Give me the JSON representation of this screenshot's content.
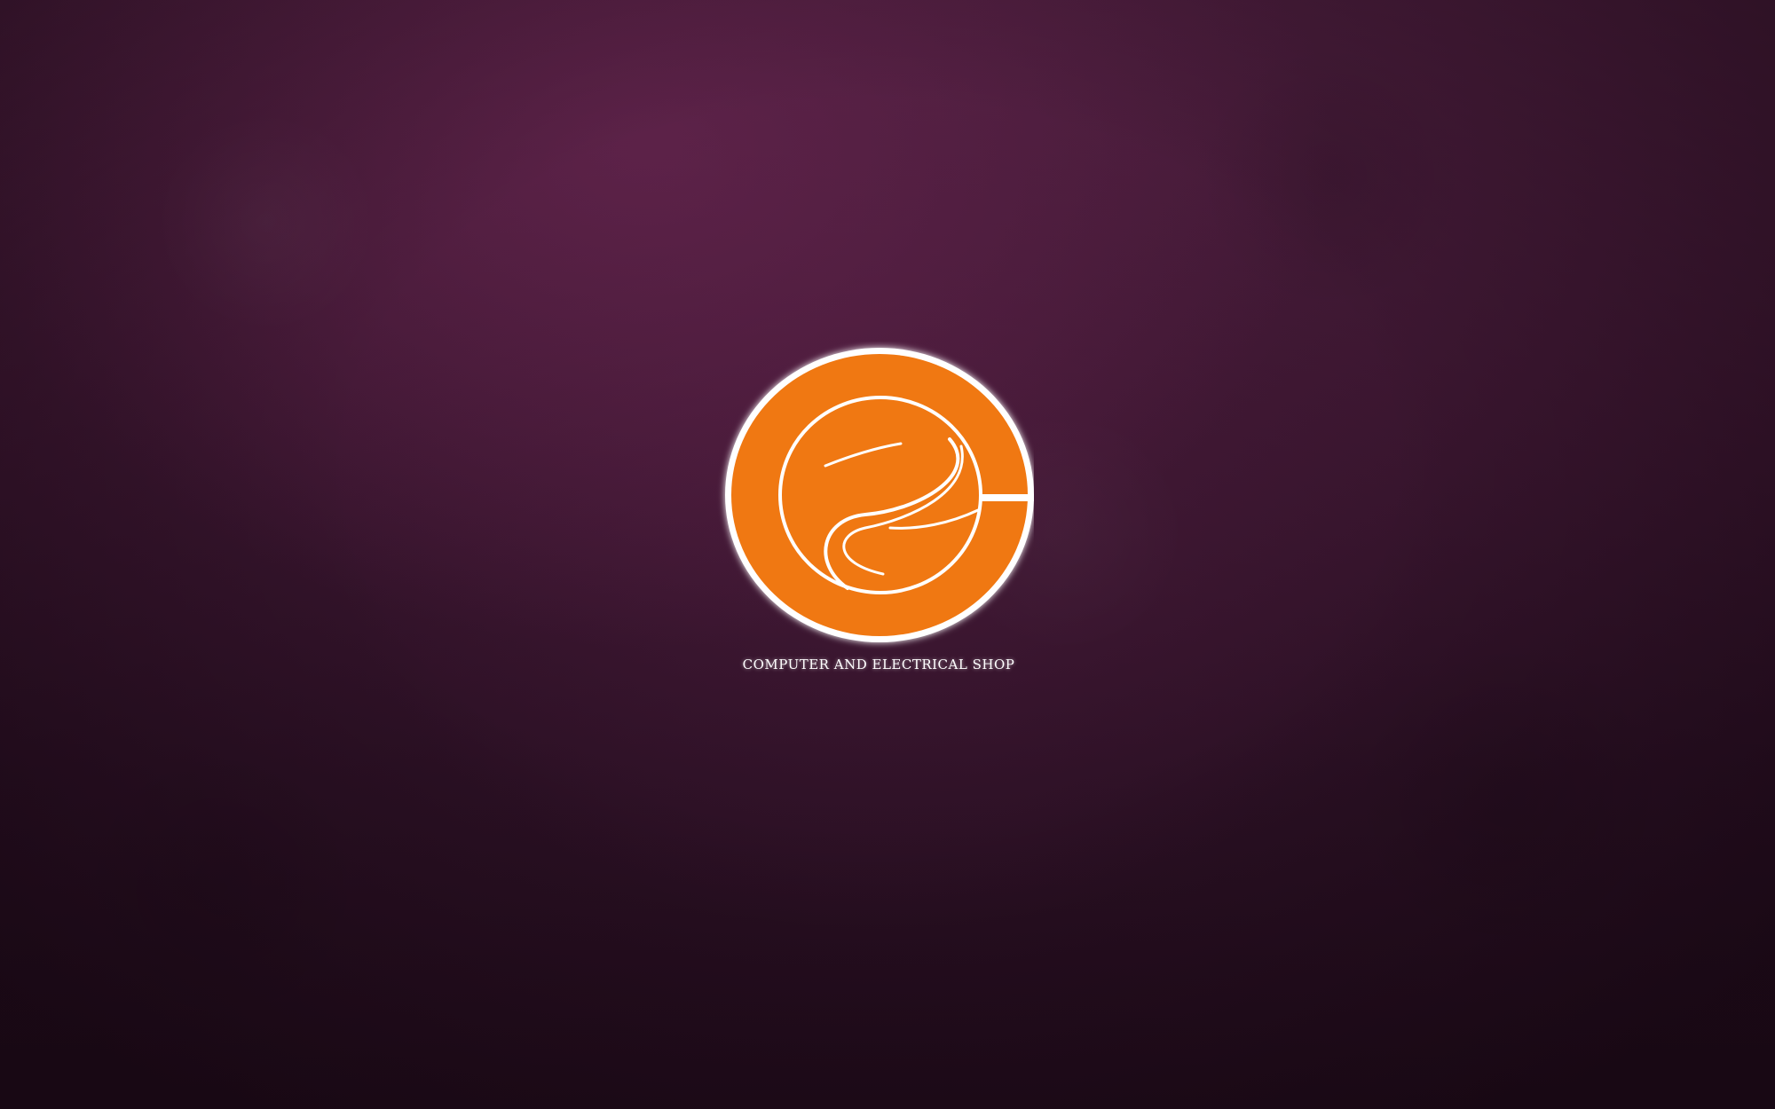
{
  "wallpaper": {
    "background_color": "#3b1630",
    "logo": {
      "icon": "orange-circle-swirl-logo",
      "fill_color": "#f07812",
      "stroke_color": "#ffffff"
    },
    "tagline": "COMPUTER AND ELECTRICAL SHOP"
  }
}
